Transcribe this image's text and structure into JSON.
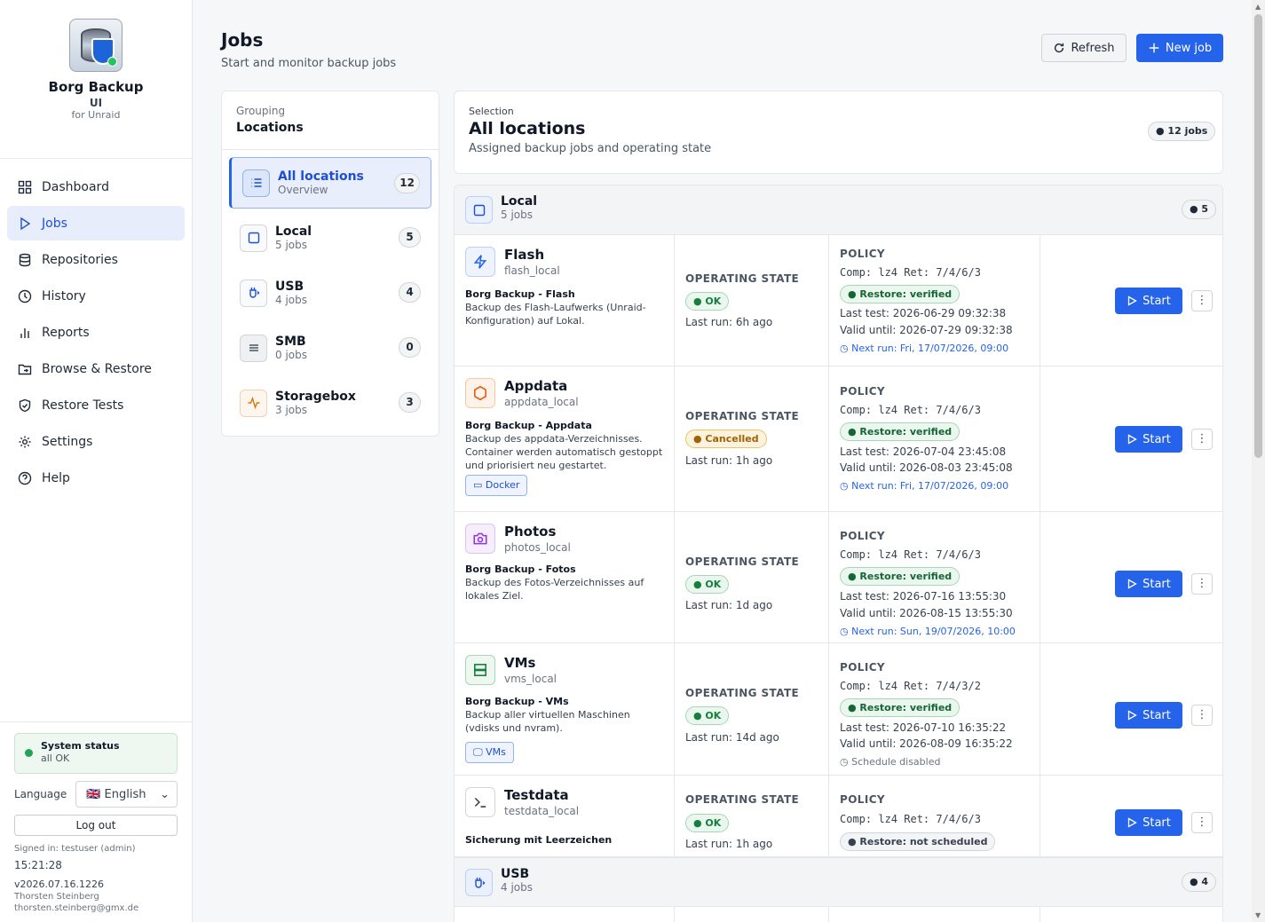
{
  "brand": {
    "title": "Borg Backup",
    "subtitle": "UI",
    "for": "for Unraid"
  },
  "nav": [
    {
      "label": "Dashboard",
      "icon": "grid-icon"
    },
    {
      "label": "Jobs",
      "icon": "play-icon",
      "active": true
    },
    {
      "label": "Repositories",
      "icon": "database-icon"
    },
    {
      "label": "History",
      "icon": "clock-icon"
    },
    {
      "label": "Reports",
      "icon": "bar-chart-icon"
    },
    {
      "label": "Browse & Restore",
      "icon": "folder-icon"
    },
    {
      "label": "Restore Tests",
      "icon": "shield-check-icon"
    },
    {
      "label": "Settings",
      "icon": "gear-icon"
    },
    {
      "label": "Help",
      "icon": "help-icon"
    }
  ],
  "system": {
    "title": "System status",
    "status": "all OK"
  },
  "language": {
    "label": "Language",
    "value": "🇬🇧 English"
  },
  "logout": "Log out",
  "signed_in": "Signed in: testuser (admin)",
  "time": "15:21:28",
  "version": "v2026.07.16.1226",
  "author": "Thorsten Steinberg",
  "email": "thorsten.steinberg@gmx.de",
  "page": {
    "title": "Jobs",
    "subtitle": "Start and monitor backup jobs",
    "refresh": "Refresh",
    "new_job": "New job"
  },
  "grouping": {
    "label": "Grouping",
    "value": "Locations",
    "items": [
      {
        "name": "All locations",
        "sub": "Overview",
        "count": "12"
      },
      {
        "name": "Local",
        "sub": "5 jobs",
        "count": "5"
      },
      {
        "name": "USB",
        "sub": "4 jobs",
        "count": "4"
      },
      {
        "name": "SMB",
        "sub": "0 jobs",
        "count": "0"
      },
      {
        "name": "Storagebox",
        "sub": "3 jobs",
        "count": "3"
      }
    ]
  },
  "selection": {
    "label": "Selection",
    "value": "All locations",
    "desc": "Assigned backup jobs and operating state",
    "badge": "● 12 jobs"
  },
  "groups": [
    {
      "name": "Local",
      "sub": "5 jobs",
      "badge": "● 5"
    },
    {
      "name": "USB",
      "sub": "4 jobs",
      "badge": "● 4"
    }
  ],
  "labels": {
    "op_state": "OPERATING STATE",
    "policy": "POLICY",
    "start": "Start"
  },
  "jobs": [
    {
      "name": "Flash",
      "id": "flash_local",
      "desc_title": "Borg Backup - Flash",
      "desc": "Backup des Flash-Laufwerks (Unraid-Konfiguration) auf Lokal.",
      "state": "● OK",
      "last_run": "Last run: 6h ago",
      "comp": "Comp: lz4  Ret: 7/4/6/3",
      "restore": "● Restore: verified",
      "last_test": "Last test: 2026-06-29 09:32:38",
      "valid": "Valid until: 2026-07-29 09:32:38",
      "next": "Next run: Fri, 17/07/2026, 09:00",
      "icon": "flash-icon"
    },
    {
      "name": "Appdata",
      "id": "appdata_local",
      "desc_title": "Borg Backup - Appdata",
      "desc": "Backup des appdata-Verzeichnisses. Container werden automatisch gestoppt und priorisiert neu gestartet.",
      "tag": "Docker",
      "state": "● Cancelled",
      "last_run": "Last run: 1h ago",
      "comp": "Comp: lz4  Ret: 7/4/6/3",
      "restore": "● Restore: verified",
      "last_test": "Last test: 2026-07-04 23:45:08",
      "valid": "Valid until: 2026-08-03 23:45:08",
      "next": "Next run: Fri, 17/07/2026, 09:00",
      "icon": "hexagon-icon"
    },
    {
      "name": "Photos",
      "id": "photos_local",
      "desc_title": "Borg Backup - Fotos",
      "desc": "Backup des Fotos-Verzeichnisses auf lokales Ziel.",
      "state": "● OK",
      "last_run": "Last run: 1d ago",
      "comp": "Comp: lz4  Ret: 7/4/6/3",
      "restore": "● Restore: verified",
      "last_test": "Last test: 2026-07-16 13:55:30",
      "valid": "Valid until: 2026-08-15 13:55:30",
      "next": "Next run: Sun, 19/07/2026, 10:00",
      "icon": "camera-icon"
    },
    {
      "name": "VMs",
      "id": "vms_local",
      "desc_title": "Borg Backup - VMs",
      "desc": "Backup aller virtuellen Maschinen (vdisks und nvram).",
      "tag": "VMs",
      "state": "● OK",
      "last_run": "Last run: 14d ago",
      "comp": "Comp: lz4  Ret: 7/4/3/2",
      "restore": "● Restore: verified",
      "last_test": "Last test: 2026-07-10 16:35:22",
      "valid": "Valid until: 2026-08-09 16:35:22",
      "next": "Schedule disabled",
      "icon": "server-icon"
    },
    {
      "name": "Testdata",
      "id": "testdata_local",
      "desc_title": "Sicherung mit Leerzeichen",
      "state": "● OK",
      "last_run": "Last run: 1h ago",
      "comp": "Comp: lz4  Ret: 7/4/6/3",
      "restore": "● Restore: not scheduled",
      "icon": "terminal-icon"
    }
  ],
  "colors": {
    "accent": "#2563eb",
    "ok": "#15803d",
    "warn": "#a16207"
  }
}
